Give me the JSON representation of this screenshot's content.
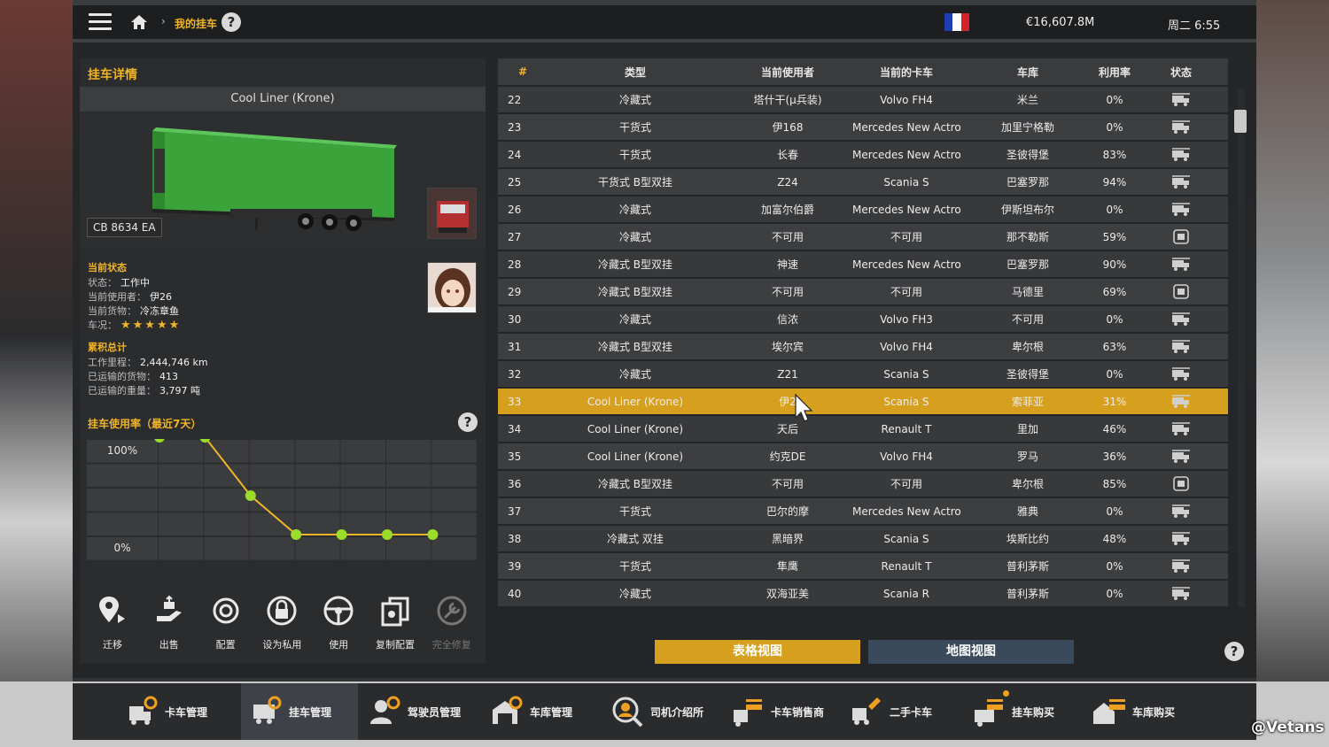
{
  "header": {
    "breadcrumb": "我的挂车",
    "money": "€16,607.8M",
    "time": "周二 6:55",
    "help": "?"
  },
  "colors": {
    "accent": "#d6a01e",
    "title": "#f0b429",
    "panel": "#2b2c2e",
    "map_button": "#3a4a5a"
  },
  "left": {
    "title": "挂车详情",
    "model": "Cool Liner (Krone)",
    "plate": "CB 8634 EA",
    "status_heading": "当前状态",
    "status_label": "状态：",
    "status_value": "工作中",
    "user_label": "当前使用者：",
    "user_value": "伊26",
    "cargo_label": "当前货物：",
    "cargo_value": "冷冻章鱼",
    "condition_label": "车况：",
    "condition_stars": "★★★★★",
    "totals_heading": "累积总计",
    "mileage_label": "工作里程：",
    "mileage_value": "2,444,746 km",
    "shipped_label": "已运输的货物：",
    "shipped_value": "413",
    "weight_label": "已运输的重量：",
    "weight_value": "3,797 吨",
    "usage_title": "挂车使用率（最近7天）"
  },
  "chart_data": {
    "type": "line",
    "title": "挂车使用率（最近7天）",
    "ytick_labels": [
      "100%",
      "0%"
    ],
    "ylim": [
      0,
      100
    ],
    "values": [
      100,
      100,
      40,
      0,
      0,
      0,
      0
    ],
    "line_color": "#f0b429",
    "point_color": "#9bdc2a",
    "grid": true
  },
  "actions": [
    {
      "label": "迁移",
      "icon": "relocate-icon"
    },
    {
      "label": "出售",
      "icon": "sell-icon"
    },
    {
      "label": "配置",
      "icon": "configure-icon"
    },
    {
      "label": "设为私用",
      "icon": "private-lock-icon"
    },
    {
      "label": "使用",
      "icon": "steering-wheel-icon"
    },
    {
      "label": "复制配置",
      "icon": "copy-config-icon"
    },
    {
      "label": "完全修复",
      "icon": "repair-icon",
      "disabled": true
    }
  ],
  "table": {
    "headers": [
      "#",
      "类型",
      "当前使用者",
      "当前的卡车",
      "车库",
      "利用率",
      "状态"
    ],
    "rows": [
      [
        "22",
        "冷藏式",
        "塔什干(μ兵装)",
        "Volvo FH4",
        "米兰",
        "0%",
        "garage"
      ],
      [
        "23",
        "干货式",
        "伊168",
        "Mercedes New Actros",
        "加里宁格勒",
        "0%",
        "garage"
      ],
      [
        "24",
        "干货式",
        "长春",
        "Mercedes New Actros",
        "圣彼得堡",
        "83%",
        "garage"
      ],
      [
        "25",
        "干货式 B型双挂",
        "Z24",
        "Scania S",
        "巴塞罗那",
        "94%",
        "garage"
      ],
      [
        "26",
        "冷藏式",
        "加富尔伯爵",
        "Mercedes New Actros",
        "伊斯坦布尔",
        "0%",
        "garage"
      ],
      [
        "27",
        "冷藏式",
        "不可用",
        "不可用",
        "那不勒斯",
        "59%",
        "parked"
      ],
      [
        "28",
        "冷藏式 B型双挂",
        "神速",
        "Mercedes New Actros",
        "巴塞罗那",
        "90%",
        "garage"
      ],
      [
        "29",
        "冷藏式 B型双挂",
        "不可用",
        "不可用",
        "马德里",
        "69%",
        "parked"
      ],
      [
        "30",
        "冷藏式",
        "信浓",
        "Volvo FH3",
        "不可用",
        "0%",
        "garage"
      ],
      [
        "31",
        "冷藏式 B型双挂",
        "埃尔宾",
        "Volvo FH4",
        "卑尔根",
        "63%",
        "garage"
      ],
      [
        "32",
        "冷藏式",
        "Z21",
        "Scania S",
        "圣彼得堡",
        "0%",
        "garage"
      ],
      [
        "33",
        "Cool Liner (Krone)",
        "伊2",
        "Scania S",
        "索菲亚",
        "31%",
        "garage"
      ],
      [
        "34",
        "Cool Liner (Krone)",
        "天后",
        "Renault T",
        "里加",
        "46%",
        "garage"
      ],
      [
        "35",
        "Cool Liner (Krone)",
        "约克DE",
        "Volvo FH4",
        "罗马",
        "36%",
        "garage"
      ],
      [
        "36",
        "冷藏式 B型双挂",
        "不可用",
        "不可用",
        "卑尔根",
        "85%",
        "parked"
      ],
      [
        "37",
        "干货式",
        "巴尔的摩",
        "Mercedes New Actros",
        "雅典",
        "0%",
        "garage"
      ],
      [
        "38",
        "冷藏式 双挂",
        "黑暗界",
        "Scania S",
        "埃斯比约",
        "48%",
        "garage"
      ],
      [
        "39",
        "干货式",
        "隼鹰",
        "Renault T",
        "普利茅斯",
        "0%",
        "garage"
      ],
      [
        "40",
        "冷藏式",
        "双海亚美",
        "Scania R",
        "普利茅斯",
        "0%",
        "garage"
      ]
    ],
    "selected_index": 11
  },
  "views": {
    "table": "表格视图",
    "map": "地图视图"
  },
  "bottom_nav": [
    {
      "label": "卡车管理",
      "icon": "truck-manage-icon"
    },
    {
      "label": "挂车管理",
      "icon": "trailer-manage-icon",
      "active": true
    },
    {
      "label": "驾驶员管理",
      "icon": "driver-manage-icon"
    },
    {
      "label": "车库管理",
      "icon": "garage-manage-icon"
    },
    {
      "label": "司机介绍所",
      "icon": "recruitment-icon"
    },
    {
      "label": "卡车销售商",
      "icon": "truck-dealer-icon"
    },
    {
      "label": "二手卡车",
      "icon": "used-truck-icon"
    },
    {
      "label": "挂车购买",
      "icon": "trailer-buy-icon",
      "notify": true
    },
    {
      "label": "车库购买",
      "icon": "garage-buy-icon"
    }
  ],
  "watermark": "@Vetans"
}
